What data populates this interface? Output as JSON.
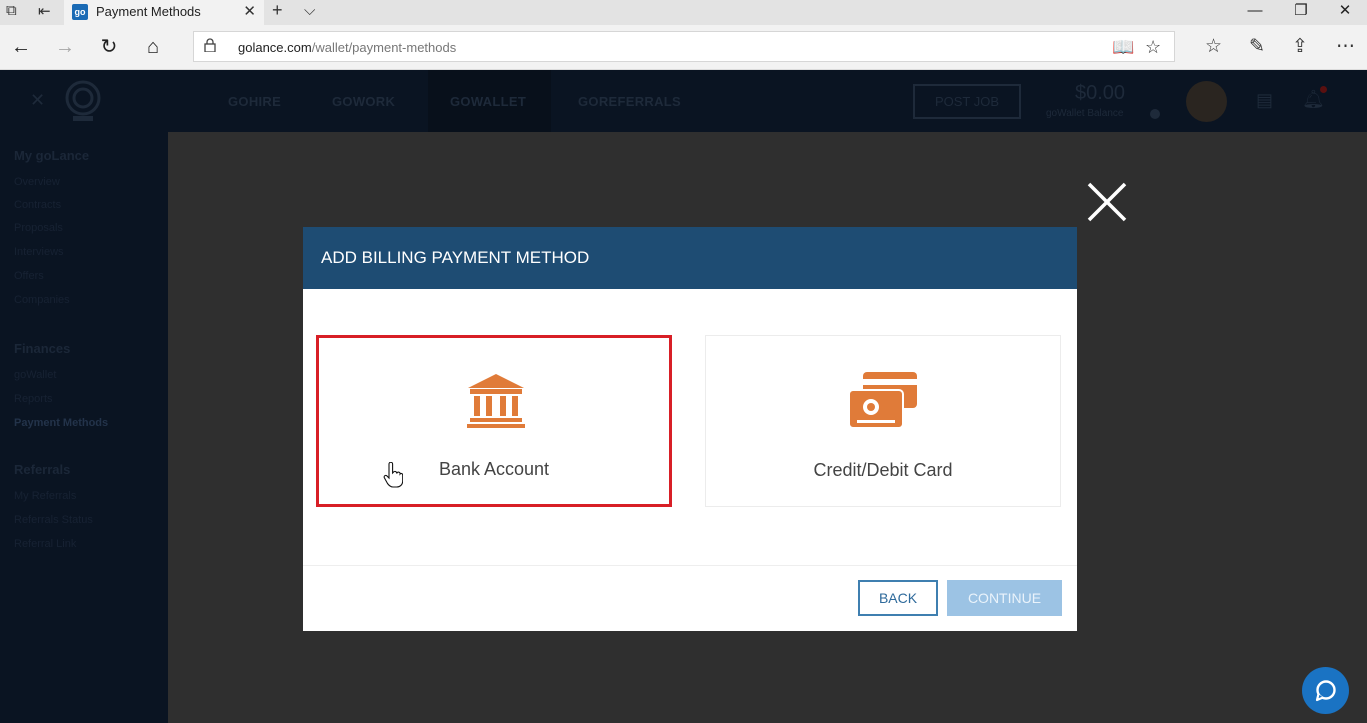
{
  "browser": {
    "tab_title": "Payment Methods",
    "favicon_text": "go",
    "address": {
      "domain": "golance.com",
      "path": "/wallet/payment-methods"
    }
  },
  "site": {
    "nav": [
      "GOHIRE",
      "GOWORK",
      "GOWALLET",
      "GOREFERRALS"
    ],
    "active_nav": "GOWALLET",
    "post_job": "POST JOB",
    "balance": "$0.00",
    "balance_label": "goWallet Balance"
  },
  "sidebar": {
    "sections": [
      {
        "title": "My goLance",
        "items": [
          "Overview",
          "Contracts",
          "Proposals",
          "Interviews",
          "Offers",
          "Companies"
        ]
      },
      {
        "title": "Finances",
        "items": [
          "goWallet",
          "Reports",
          "Payment Methods"
        ]
      },
      {
        "title": "Referrals",
        "items": [
          "My Referrals",
          "Referrals Status",
          "Referral Link"
        ]
      }
    ],
    "active_item": "Payment Methods"
  },
  "modal": {
    "title": "ADD BILLING PAYMENT METHOD",
    "options": [
      {
        "label": "Bank Account",
        "icon": "bank-icon",
        "selected": true
      },
      {
        "label": "Credit/Debit Card",
        "icon": "credit-card-icon",
        "selected": false
      }
    ],
    "back": "BACK",
    "continue": "CONTINUE"
  },
  "colors": {
    "modal_header": "#1e4c73",
    "icon_orange": "#e07b39",
    "selected_border": "#d81f26",
    "back_border": "#3f7fb0",
    "continue_disabled": "#9cc3e4",
    "chat": "#1a73c3"
  }
}
